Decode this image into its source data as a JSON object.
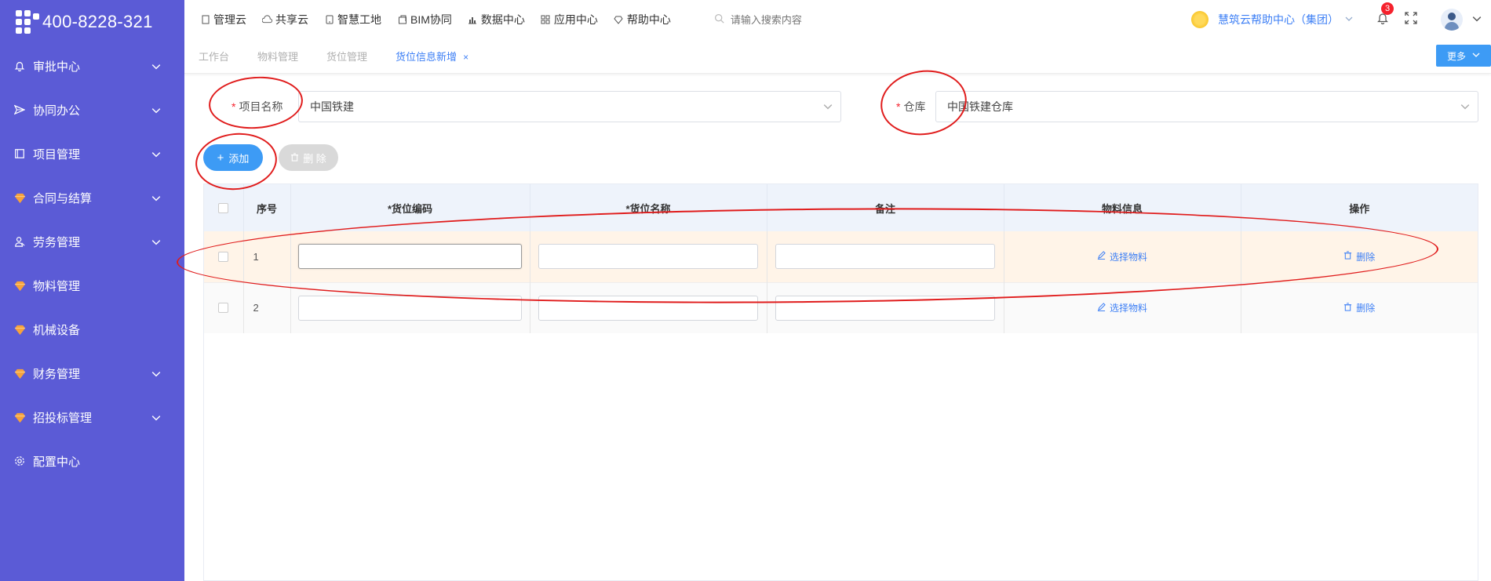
{
  "sidebar": {
    "logo_text": "400-8228-321",
    "items": [
      {
        "label": "审批中心",
        "icon": "bell-icon",
        "expandable": true
      },
      {
        "label": "协同办公",
        "icon": "send-icon",
        "expandable": true
      },
      {
        "label": "项目管理",
        "icon": "book-icon",
        "expandable": true
      },
      {
        "label": "合同与结算",
        "icon": "gem-icon",
        "expandable": true
      },
      {
        "label": "劳务管理",
        "icon": "worker-icon",
        "expandable": true
      },
      {
        "label": "物料管理",
        "icon": "gem-icon",
        "expandable": false
      },
      {
        "label": "机械设备",
        "icon": "gem-icon",
        "expandable": false
      },
      {
        "label": "财务管理",
        "icon": "gem-icon",
        "expandable": true
      },
      {
        "label": "招投标管理",
        "icon": "gem-icon",
        "expandable": true
      },
      {
        "label": "配置中心",
        "icon": "gear-icon",
        "expandable": false
      }
    ]
  },
  "topnav": {
    "items": [
      {
        "label": "管理云"
      },
      {
        "label": "共享云"
      },
      {
        "label": "智慧工地"
      },
      {
        "label": "BIM协同"
      },
      {
        "label": "数据中心"
      },
      {
        "label": "应用中心"
      },
      {
        "label": "帮助中心"
      }
    ],
    "search_placeholder": "请输入搜索内容",
    "org_name": "慧筑云帮助中心（集团）",
    "notification_count": "3"
  },
  "tabs": {
    "items": [
      {
        "label": "工作台"
      },
      {
        "label": "物料管理"
      },
      {
        "label": "货位管理"
      },
      {
        "label": "货位信息新增",
        "active": true
      }
    ],
    "close_symbol": "×",
    "more_label": "更多"
  },
  "form": {
    "project_label": "项目名称",
    "project_value": "中国铁建",
    "warehouse_label": "仓库",
    "warehouse_value": "中国铁建仓库",
    "required_mark": "*"
  },
  "actions": {
    "add_label": "添加",
    "delete_label": "删 除"
  },
  "table": {
    "columns": [
      "序号",
      "*货位编码",
      "*货位名称",
      "备注",
      "物料信息",
      "操作"
    ],
    "rows": [
      {
        "index": "1",
        "code": "",
        "name": "",
        "remark": "",
        "material_action": "选择物料",
        "delete_action": "删除"
      },
      {
        "index": "2",
        "code": "",
        "name": "",
        "remark": "",
        "material_action": "选择物料",
        "delete_action": "删除"
      }
    ]
  },
  "colors": {
    "sidebar_bg": "#5b5bd6",
    "primary": "#3d9bf5",
    "link": "#3d7ff5",
    "annotation": "#e01c1c",
    "highlight_row": "#fff4e8"
  }
}
